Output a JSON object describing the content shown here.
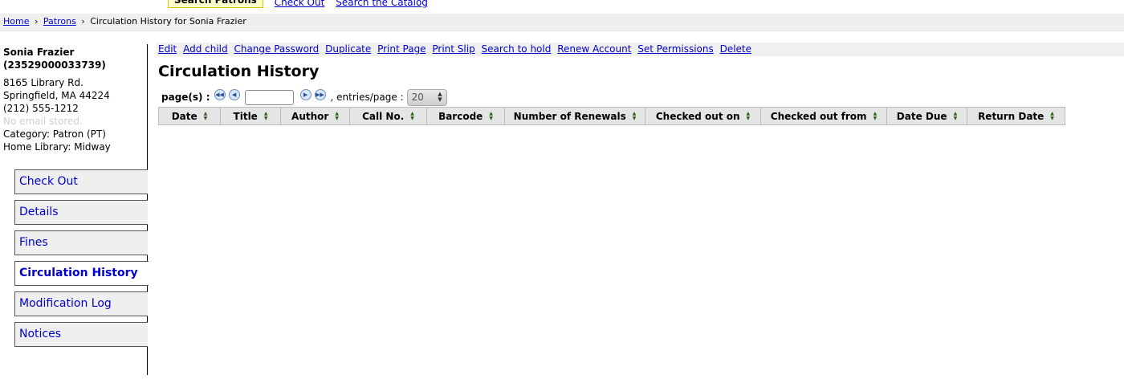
{
  "header": {
    "tabs": [
      {
        "label": "Search Patrons"
      },
      {
        "label": "Check Out"
      },
      {
        "label": "Search the Catalog"
      }
    ]
  },
  "breadcrumb": {
    "home": "Home",
    "patrons": "Patrons",
    "current": "Circulation History for Sonia Frazier",
    "separator": "›"
  },
  "patron": {
    "name": "Sonia Frazier",
    "cardnumber": "(23529000033739)",
    "address1": "8165 Library Rd.",
    "address2": "Springfield, MA 44224",
    "phone": "(212) 555-1212",
    "email": "No email stored.",
    "category": "Category: Patron (PT)",
    "home_library": "Home Library: Midway"
  },
  "nav": {
    "items": [
      {
        "label": "Check Out"
      },
      {
        "label": "Details"
      },
      {
        "label": "Fines"
      },
      {
        "label": "Circulation History"
      },
      {
        "label": "Modification Log"
      },
      {
        "label": "Notices"
      }
    ]
  },
  "toolbar": {
    "links": [
      {
        "label": "Edit"
      },
      {
        "label": "Add child"
      },
      {
        "label": "Change Password"
      },
      {
        "label": "Duplicate"
      },
      {
        "label": "Print Page"
      },
      {
        "label": "Print Slip"
      },
      {
        "label": "Search to hold"
      },
      {
        "label": "Renew Account"
      },
      {
        "label": "Set Permissions"
      },
      {
        "label": "Delete"
      }
    ]
  },
  "main": {
    "title": "Circulation History",
    "pager_label": "page(s) :",
    "page_value": "",
    "entries_label": ", entries/page :",
    "entries_value": "20"
  },
  "table": {
    "columns": [
      "Date",
      "Title",
      "Author",
      "Call No.",
      "Barcode",
      "Number of Renewals",
      "Checked out on",
      "Checked out from",
      "Date Due",
      "Return Date"
    ]
  },
  "icons": {
    "first": "first-page-icon",
    "prev": "previous-page-icon",
    "next": "next-page-icon",
    "last": "last-page-icon",
    "sort": "sort-arrows-icon"
  },
  "colors": {
    "link": "#0000cc",
    "header_bg": "#e5e5e5",
    "active_tab_bg": "#ffffcc"
  }
}
